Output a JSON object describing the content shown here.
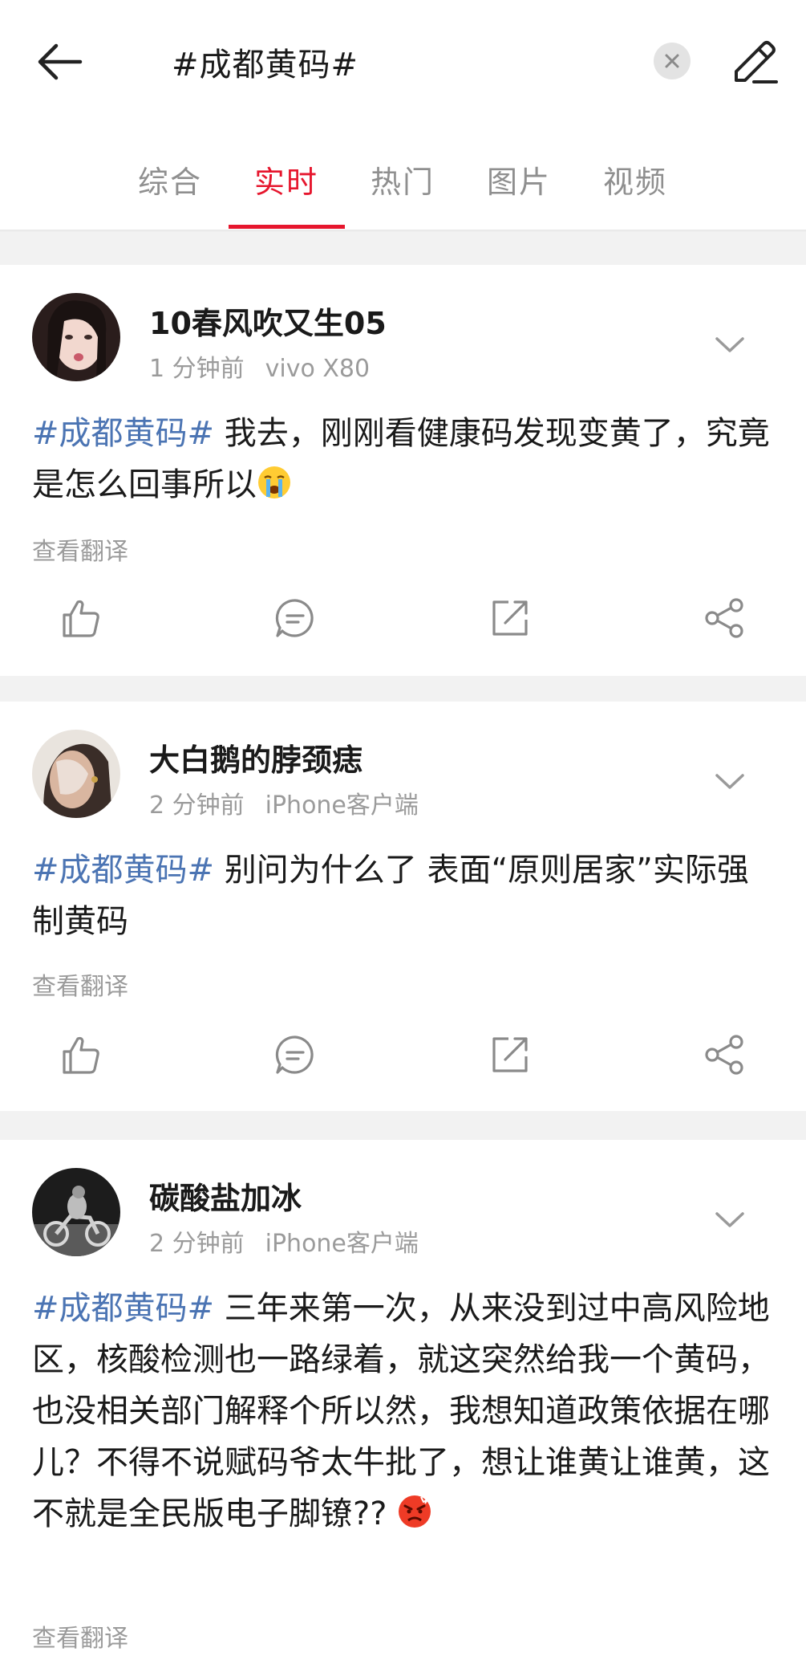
{
  "header": {
    "search_query": "#成都黄码#",
    "back_icon": "arrow-left-icon",
    "clear_icon": "close-icon",
    "edit_icon": "pencil-icon"
  },
  "tabs": [
    {
      "label": "综合",
      "active": false
    },
    {
      "label": "实时",
      "active": true
    },
    {
      "label": "热门",
      "active": false
    },
    {
      "label": "图片",
      "active": false
    },
    {
      "label": "视频",
      "active": false
    }
  ],
  "colors": {
    "accent": "#e6162d",
    "hashtag": "#4b74b3",
    "muted": "#9b9b9b"
  },
  "posts": [
    {
      "username": "10春风吹又生05",
      "time": "1 分钟前",
      "source": "vivo X80",
      "hashtag": "#成都黄码#",
      "text": " 我去，刚刚看健康码发现变黄了，究竟是怎么回事所以",
      "emoji": "crying-face-emoji",
      "translate": "查看翻译"
    },
    {
      "username": "大白鹅的脖颈痣",
      "time": "2 分钟前",
      "source": "iPhone客户端",
      "hashtag": "#成都黄码#",
      "text": " 别问为什么了 表面“原则居家”实际强制黄码",
      "translate": "查看翻译"
    },
    {
      "username": "碳酸盐加冰",
      "time": "2 分钟前",
      "source": "iPhone客户端",
      "hashtag": "#成都黄码#",
      "text": " 三年来第一次，从来没到过中高风险地区，核酸检测也一路绿着，就这突然给我一个黄码，也没相关部门解释个所以然，我想知道政策依据在哪儿？不得不说赋码爷太牛批了，想让谁黄让谁黄，这不就是全民版电子脚镣?? ",
      "emoji": "angry-face-emoji",
      "translate": "查看翻译"
    }
  ],
  "action_icons": [
    "thumbs-up-icon",
    "comment-icon",
    "repost-icon",
    "share-icon"
  ]
}
